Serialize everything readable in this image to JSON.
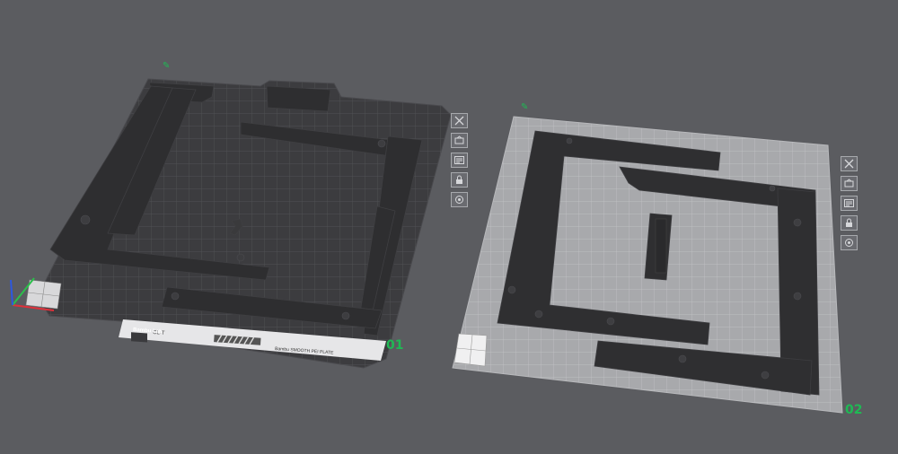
{
  "app": {
    "colors": {
      "background": "#5b5c60",
      "label_green": "#1fb954",
      "part_dark": "#2e2e30",
      "plate_dark": "#3a3a3d",
      "plate_light": "#a9aaad"
    }
  },
  "plates": [
    {
      "label": "01",
      "brand_text": "Bambu Lab",
      "model_text": "CL-T",
      "footer_text": "Bambu SMOOTH PEI PLATE",
      "toolbar": [
        {
          "icon": "close-icon"
        },
        {
          "icon": "auto-orient-icon"
        },
        {
          "icon": "arrange-icon"
        },
        {
          "icon": "lock-icon"
        },
        {
          "icon": "settings-icon"
        }
      ]
    },
    {
      "label": "02",
      "toolbar": [
        {
          "icon": "close-icon"
        },
        {
          "icon": "auto-orient-icon"
        },
        {
          "icon": "arrange-icon"
        },
        {
          "icon": "lock-icon"
        },
        {
          "icon": "settings-icon"
        }
      ]
    }
  ]
}
